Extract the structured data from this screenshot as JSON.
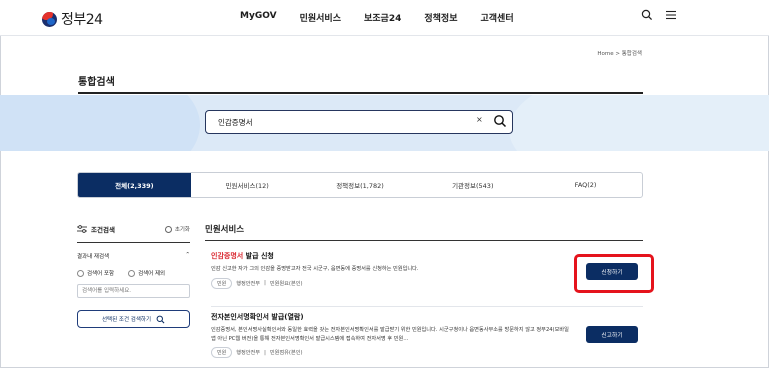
{
  "header": {
    "logo_text": "정부24",
    "nav": [
      "MyGOV",
      "민원서비스",
      "보조금24",
      "정책정보",
      "고객센터"
    ],
    "search_icon": "search-icon",
    "menu_icon": "hamburger-icon"
  },
  "breadcrumb": {
    "home": "Home",
    "separator": ">",
    "current": "통합검색"
  },
  "page_title": "통합검색",
  "search": {
    "value": "인감증명서",
    "clear_label": "×"
  },
  "tabs": [
    {
      "label": "전체(2,339)",
      "active": true
    },
    {
      "label": "민원서비스(12)",
      "active": false
    },
    {
      "label": "정책정보(1,782)",
      "active": false
    },
    {
      "label": "기관정보(543)",
      "active": false
    },
    {
      "label": "FAQ(2)",
      "active": false
    }
  ],
  "filter": {
    "title": "조건검색",
    "reset_label": "초기화",
    "refine_label": "결과내 재검색",
    "include_label": "검색어 포함",
    "exclude_label": "검색어 제외",
    "input_placeholder": "검색어를 입력하세요.",
    "button_label": "선택된 조건 검색하기"
  },
  "results": {
    "section_title": "민원서비스",
    "items": [
      {
        "title_highlight": "인감증명서",
        "title_rest": " 발급 신청",
        "desc": "인감 신고한 자가 그의 인감을 증명받고자 전국 시군구, 읍면동에 증명서를 신청하는 민원입니다.",
        "chip": "민원",
        "org": "행정안전부",
        "sep": "|",
        "fee": "민원원요(본인)",
        "button": "신청하기"
      },
      {
        "title": "전자본인서명확인서 발급(열람)",
        "desc": "인감증명서, 본인서명사실확인서와 동일한 효력을 갖는 전자본인서명확인서를 발급받기 위한 민원입니다. 시군구청이나 읍면동사무소를 방문하지 않고 정부24(모바일앱 아닌 PC웹 버전)을 통해 전자본인서명확인서 발급시스템에 접속하여 전자서명 후 민원…",
        "chip": "민원",
        "org": "행정안전부",
        "sep": "|",
        "fee": "민원점유(본인)",
        "button": "신고하기"
      }
    ]
  },
  "colors": {
    "primary": "#0b2d63",
    "highlight": "#d9252d",
    "annotation": "#e5131c",
    "band": "#dce9f7"
  }
}
